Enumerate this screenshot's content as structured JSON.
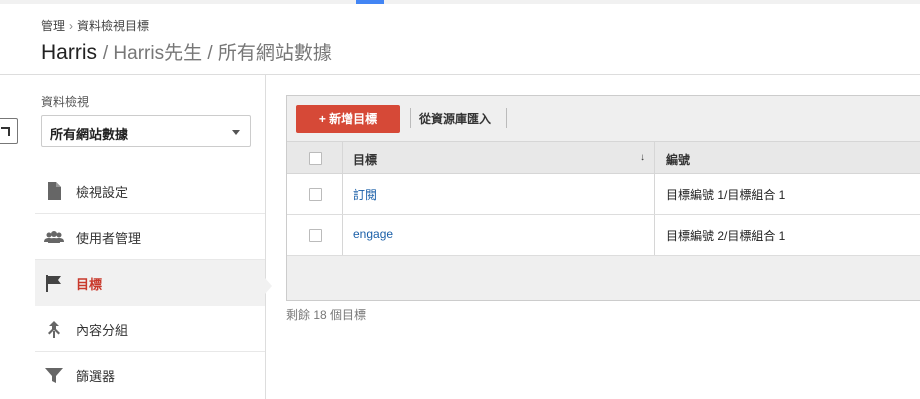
{
  "breadcrumb": {
    "admin": "管理",
    "separator": "›",
    "section": "資料檢視目標"
  },
  "title": {
    "account": "Harris",
    "path": "/ Harris先生 / 所有網站數據"
  },
  "sidebar": {
    "view_label": "資料檢視",
    "view_select": "所有網站數據",
    "items": [
      {
        "label": "檢視設定",
        "icon": "document-icon"
      },
      {
        "label": "使用者管理",
        "icon": "users-icon"
      },
      {
        "label": "目標",
        "icon": "flag-icon"
      },
      {
        "label": "內容分組",
        "icon": "content-grouping-icon"
      },
      {
        "label": "篩選器",
        "icon": "filter-icon"
      }
    ]
  },
  "toolbar": {
    "new_goal": "+ 新增目標",
    "import_gallery": "從資源庫匯入"
  },
  "table": {
    "headers": {
      "goal": "目標",
      "number": "編號"
    },
    "rows": [
      {
        "name": "訂閱",
        "number": "目標編號 1/目標組合 1"
      },
      {
        "name": "engage",
        "number": "目標編號 2/目標組合 1"
      }
    ]
  },
  "footer": {
    "remaining": "剩餘 18 個目標"
  },
  "colors": {
    "accent": "#d64937",
    "active_text": "#c9392c",
    "link": "#1a5fa8",
    "topbar_accent": "#4285f4"
  }
}
